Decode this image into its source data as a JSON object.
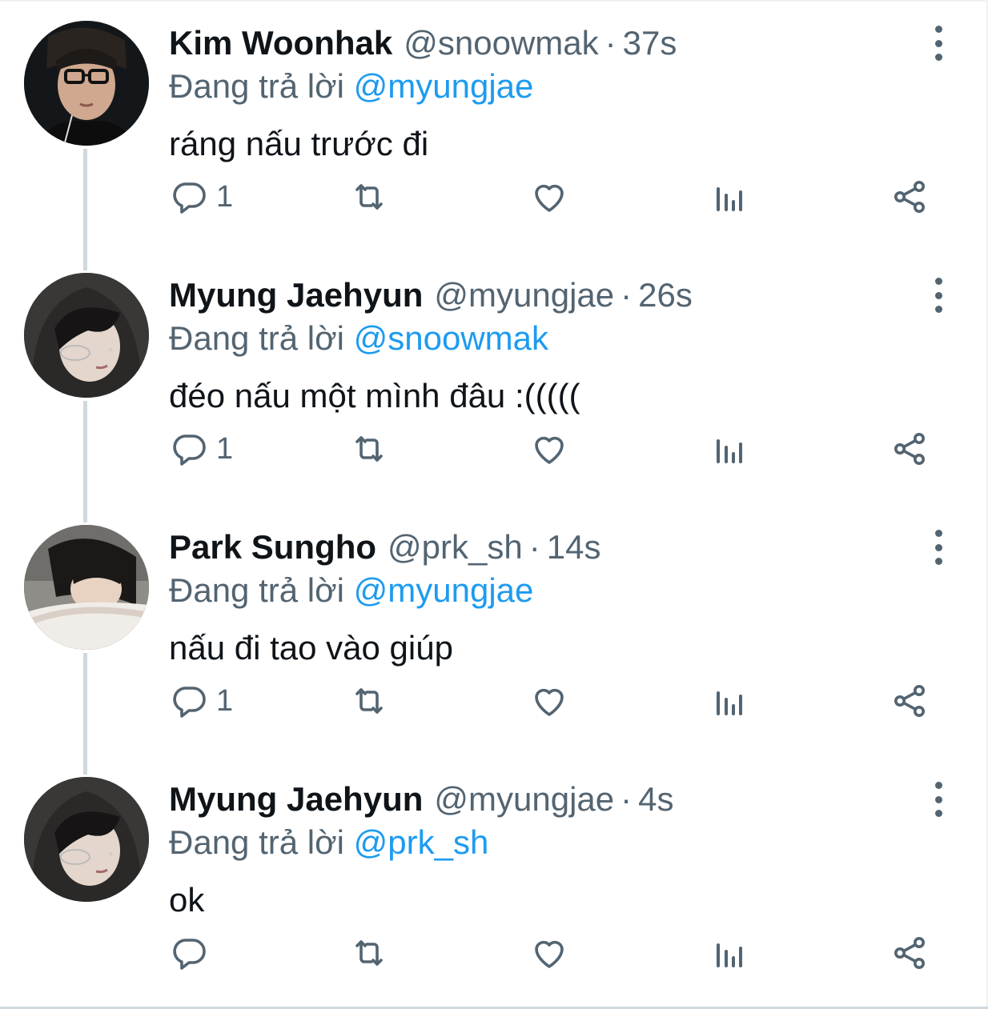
{
  "tweets": [
    {
      "name": "Kim Woonhak",
      "handle": "@snoowmak",
      "separator": "·",
      "time": "37s",
      "replying_prefix": "Đang trả lời",
      "replying_to": "@myungjae",
      "text": "ráng nấu trước đi",
      "reply_count": "1",
      "avatar": "avatar-glasses"
    },
    {
      "name": "Myung Jaehyun",
      "handle": "@myungjae",
      "separator": "·",
      "time": "26s",
      "replying_prefix": "Đang trả lời",
      "replying_to": "@snoowmak",
      "text": "đéo nấu một mình đâu :(((((",
      "reply_count": "1",
      "avatar": "avatar-hood"
    },
    {
      "name": "Park Sungho",
      "handle": "@prk_sh",
      "separator": "·",
      "time": "14s",
      "replying_prefix": "Đang trả lời",
      "replying_to": "@myungjae",
      "text": "nấu đi tao vào giúp",
      "reply_count": "1",
      "avatar": "avatar-lying"
    },
    {
      "name": "Myung Jaehyun",
      "handle": "@myungjae",
      "separator": "·",
      "time": "4s",
      "replying_prefix": "Đang trả lời",
      "replying_to": "@prk_sh",
      "text": "ok",
      "reply_count": "",
      "avatar": "avatar-hood"
    }
  ],
  "icons": {
    "reply": "reply-icon",
    "retweet": "retweet-icon",
    "like": "heart-icon",
    "views": "analytics-icon",
    "share": "share-icon",
    "more": "more-vertical-icon"
  },
  "colors": {
    "text": "#0f1419",
    "secondary": "#536471",
    "mention": "#1d9bf0",
    "thread_line": "#cfd9de"
  }
}
